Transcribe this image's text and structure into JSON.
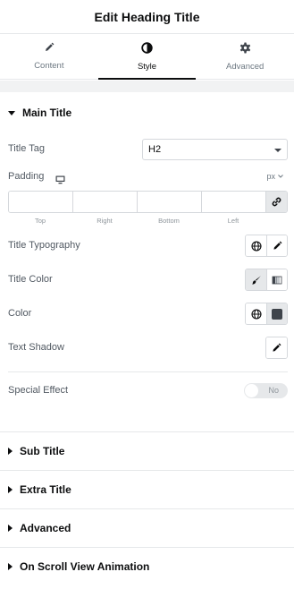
{
  "header": {
    "title": "Edit Heading Title"
  },
  "tabs": [
    {
      "label": "Content",
      "icon": "pencil-icon",
      "active": false
    },
    {
      "label": "Style",
      "icon": "contrast-icon",
      "active": true
    },
    {
      "label": "Advanced",
      "icon": "gear-icon",
      "active": false
    }
  ],
  "main_title": {
    "heading": "Main Title",
    "title_tag": {
      "label": "Title Tag",
      "value": "H2"
    },
    "padding": {
      "label": "Padding",
      "device_icon": "desktop-icon",
      "unit": "px",
      "sides": [
        "Top",
        "Right",
        "Bottom",
        "Left"
      ]
    },
    "title_typography": {
      "label": "Title Typography"
    },
    "title_color": {
      "label": "Title Color"
    },
    "color": {
      "label": "Color"
    },
    "text_shadow": {
      "label": "Text Shadow"
    },
    "special_effect": {
      "label": "Special Effect",
      "toggle": "No"
    }
  },
  "sections": [
    {
      "label": "Sub Title"
    },
    {
      "label": "Extra Title"
    },
    {
      "label": "Advanced"
    },
    {
      "label": "On Scroll View Animation"
    }
  ],
  "colors": {
    "text_dark": "#0c0d0e",
    "text_label": "#515962",
    "border": "#d5d8dc",
    "active_bg": "#e6e8ea"
  }
}
